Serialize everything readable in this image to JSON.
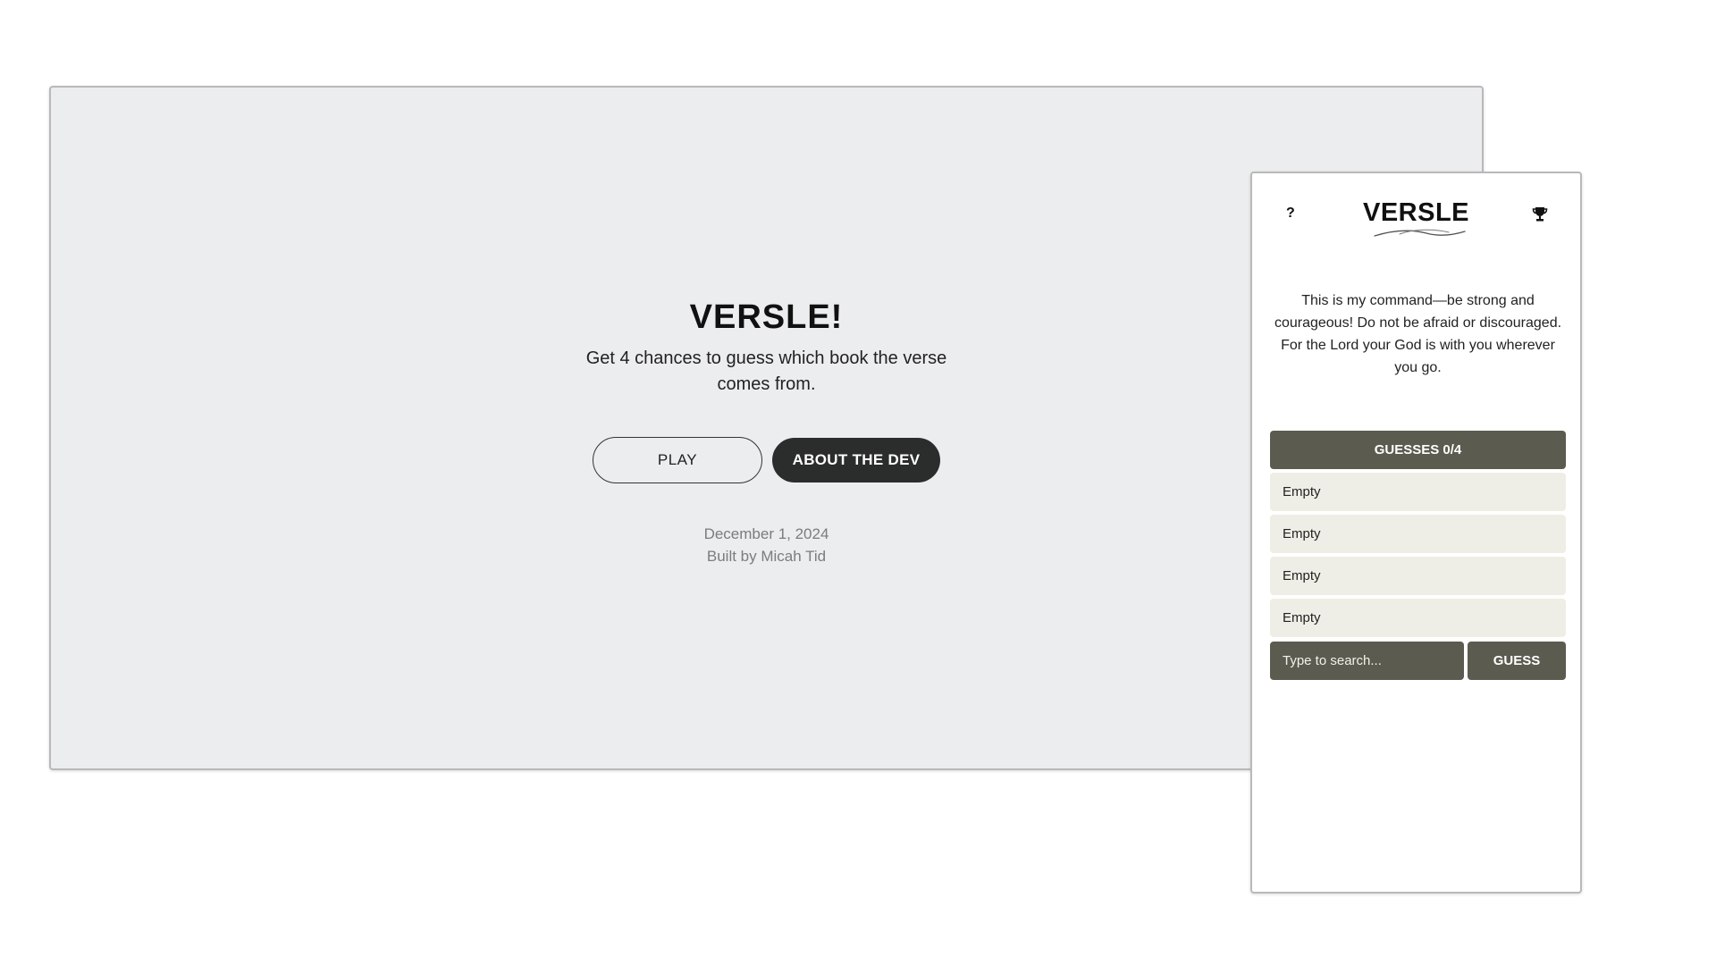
{
  "desktop": {
    "title": "VERSLE!",
    "subtitle": "Get 4 chances to guess which book the verse comes from.",
    "play_label": "PLAY",
    "about_label": "ABOUT THE DEV",
    "date": "December 1, 2024",
    "credit": "Built by Micah Tid"
  },
  "mobile": {
    "help_label": "?",
    "logo_text": "VERSLE",
    "trophy_icon": "trophy-icon",
    "verse": "This is my command—be strong and courageous! Do not be afraid or discouraged. For the Lord your God is with you wherever you go.",
    "guesses_header": "GUESSES 0/4",
    "slots": [
      "Empty",
      "Empty",
      "Empty",
      "Empty"
    ],
    "search_placeholder": "Type to search...",
    "guess_label": "GUESS"
  },
  "colors": {
    "desktop_bg": "#ecedee",
    "accent": "#5b5b4f",
    "slot_bg": "#eeeee6",
    "dark_button": "#2b2c2c"
  }
}
